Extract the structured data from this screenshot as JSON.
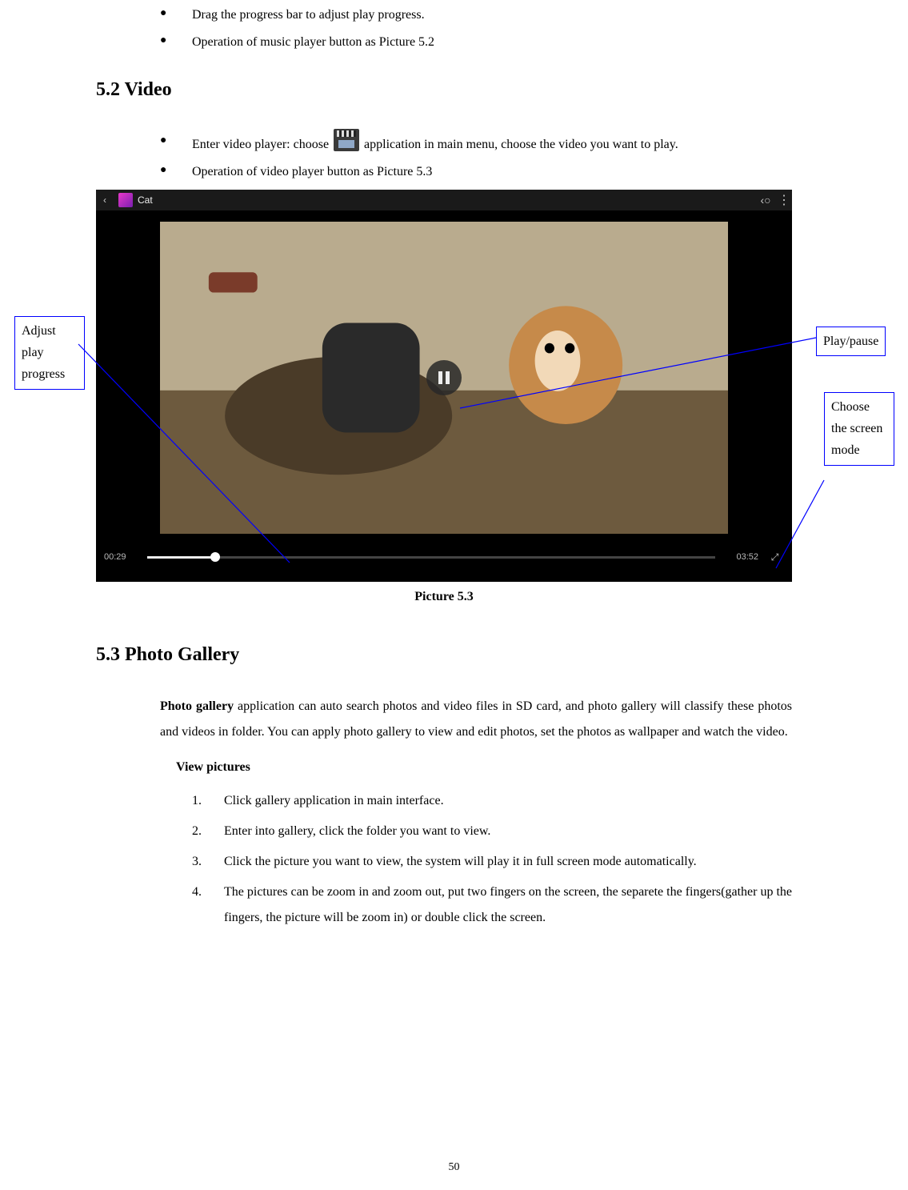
{
  "top_bullets": [
    "Drag the progress bar to adjust play progress.",
    "Operation of music player button as Picture 5.2"
  ],
  "section_video": {
    "heading": "5.2 Video",
    "bullets": {
      "b1_pre": "Enter video player: choose ",
      "b1_post": "application in main menu, choose the video you want to play.",
      "b2": "Operation of video player button as Picture 5.3"
    }
  },
  "video_player": {
    "title": "Cat",
    "time_elapsed": "00:29",
    "time_total": "03:52"
  },
  "caption": "Picture 5.3",
  "callouts": {
    "adjust": "Adjust play progress",
    "playpause": "Play/pause",
    "screenmode": "Choose the screen mode"
  },
  "section_gallery": {
    "heading": "5.3 Photo Gallery",
    "para_bold": "Photo gallery",
    "para_rest": " application can auto search photos and video files in SD card, and photo gallery will classify these photos and videos in folder. You can apply photo gallery to view and edit photos, set the photos as wallpaper and watch the video.",
    "subhead": "View pictures",
    "steps": [
      "Click gallery application in main interface.",
      "Enter into gallery, click the folder you want to view.",
      "Click the picture you want to view, the system will play it in full screen mode automatically.",
      "The pictures can be zoom in and zoom out, put two fingers on the screen, the separete the fingers(gather up the fingers, the picture will be zoom in) or double click the screen."
    ]
  },
  "page_number": "50"
}
